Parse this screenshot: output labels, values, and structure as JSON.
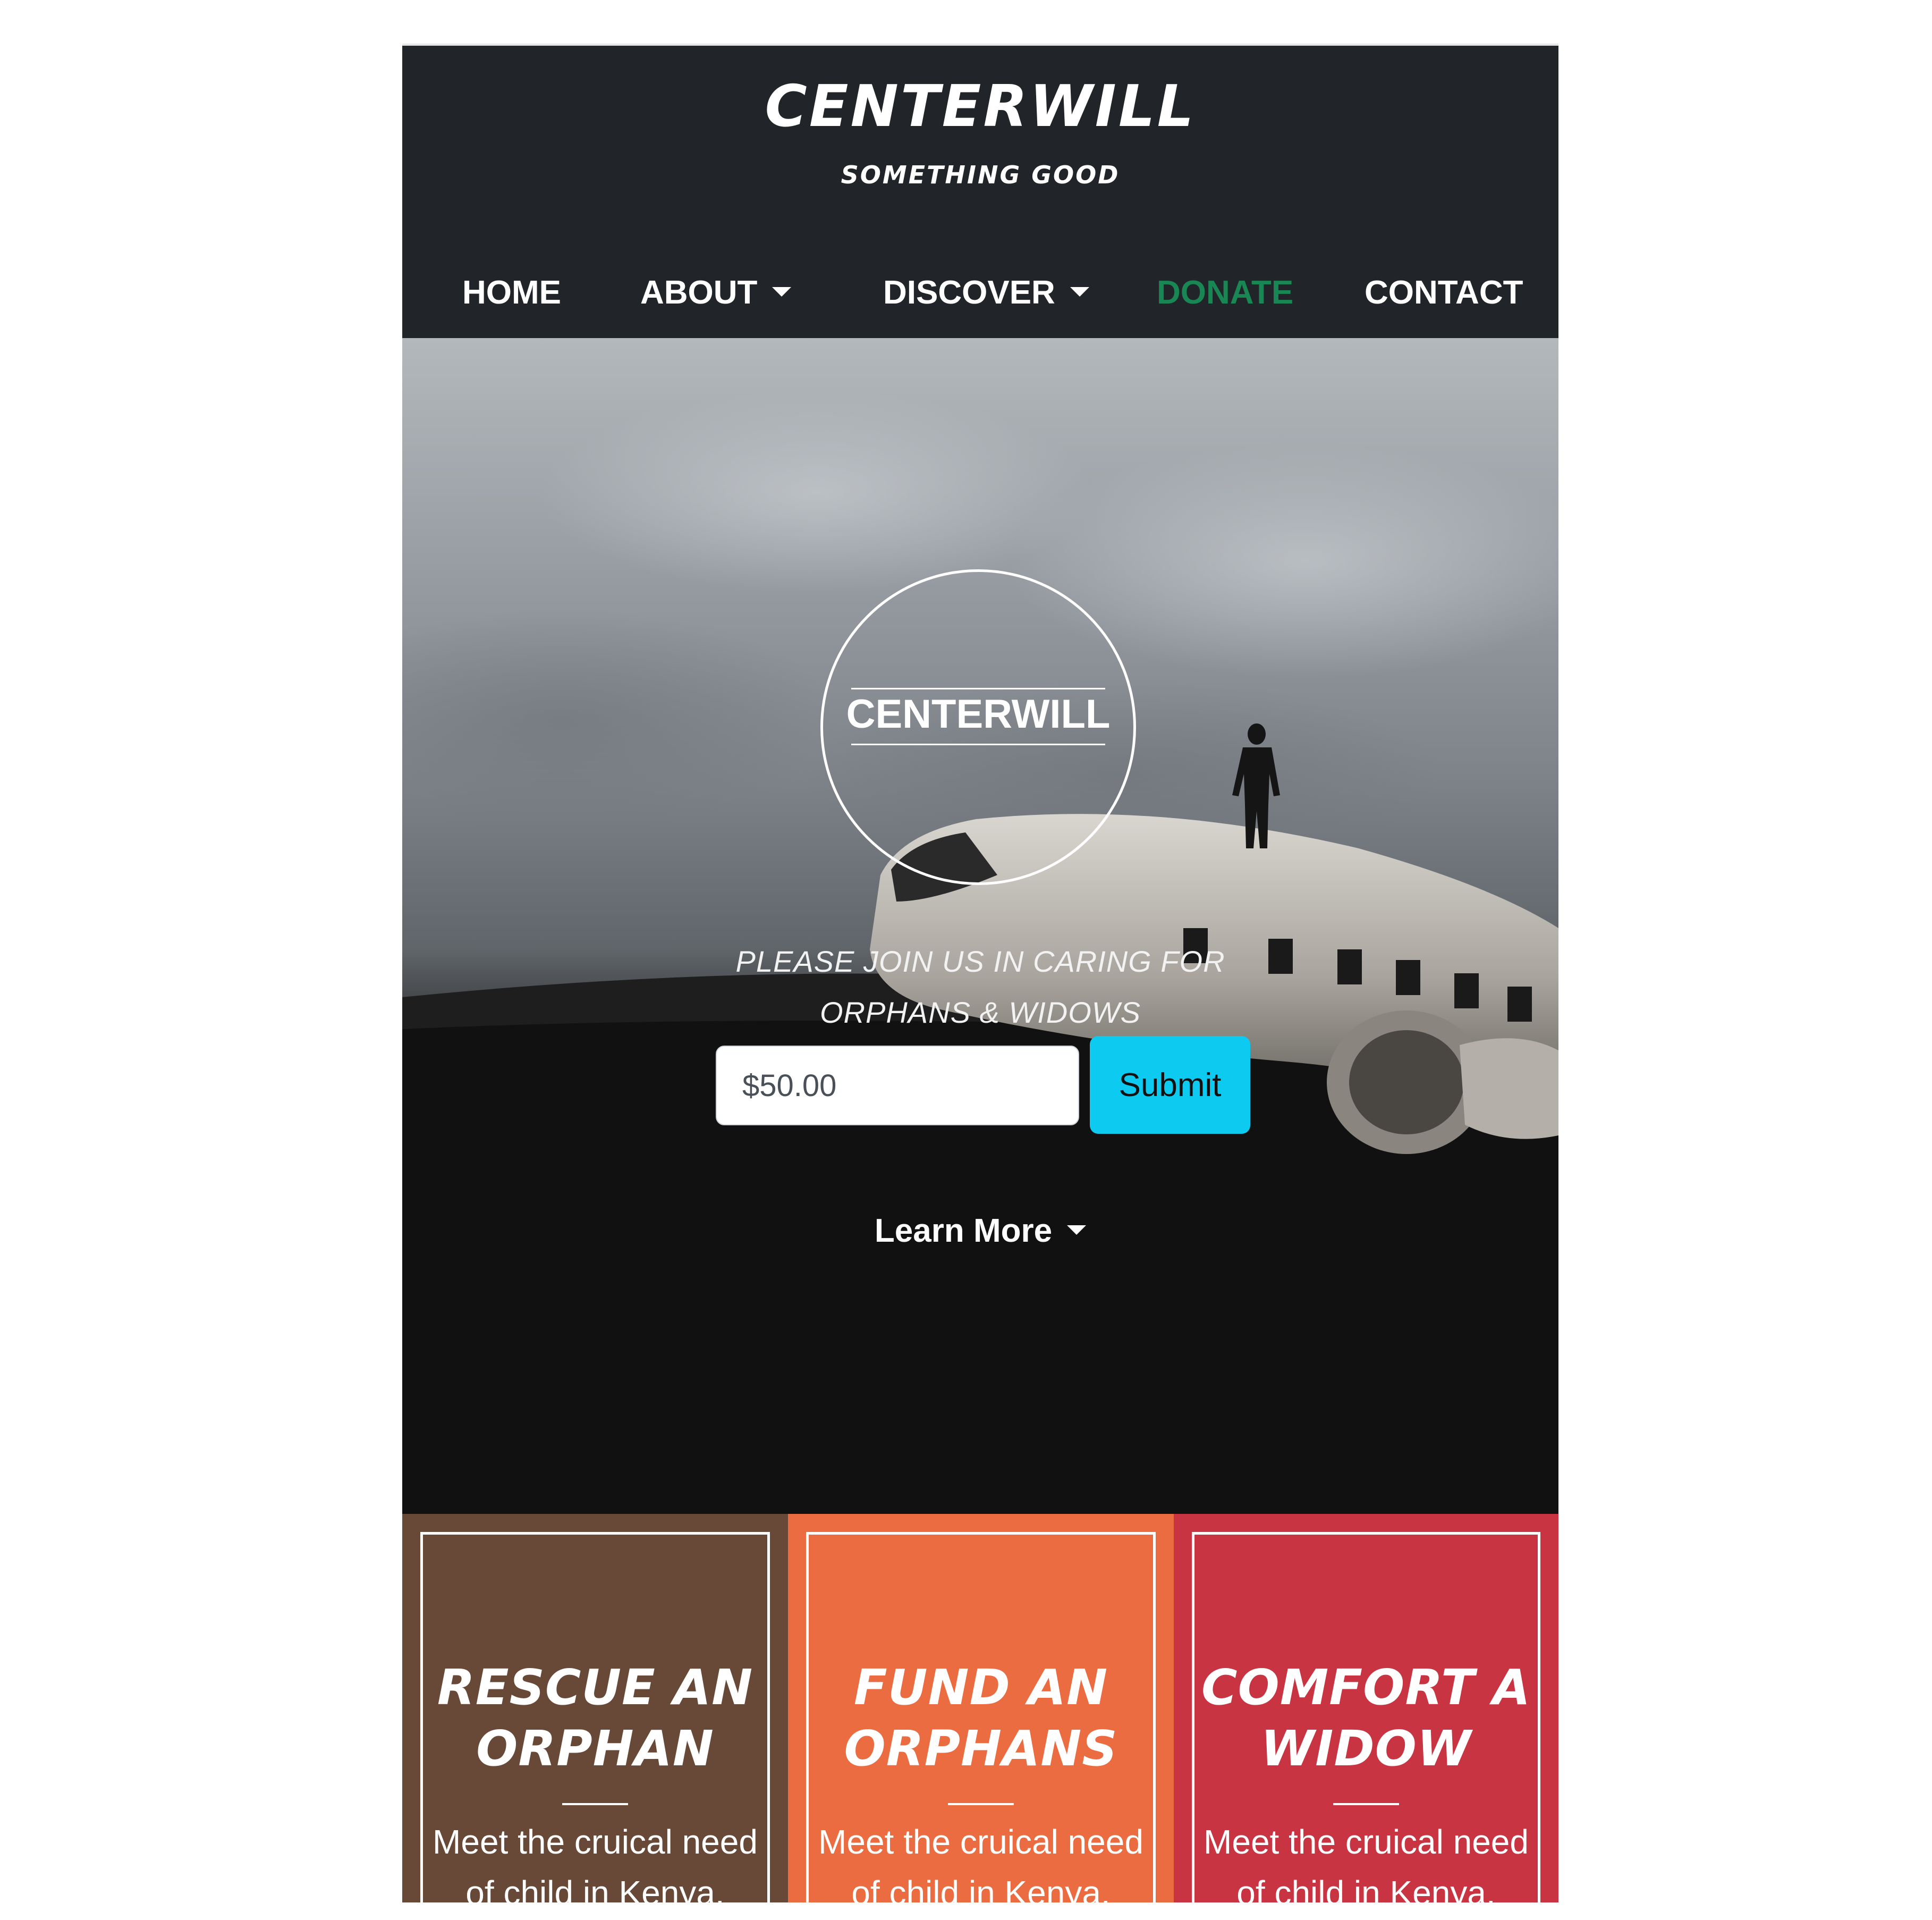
{
  "header": {
    "brand": "CENTERWILL",
    "tagline": "SOMETHING GOOD",
    "nav": [
      {
        "label": "HOME",
        "dropdown": false,
        "active": false
      },
      {
        "label": "ABOUT",
        "dropdown": true,
        "active": false
      },
      {
        "label": "DISCOVER",
        "dropdown": true,
        "active": false
      },
      {
        "label": "DONATE",
        "dropdown": false,
        "active": true
      },
      {
        "label": "CONTACT",
        "dropdown": false,
        "active": false
      }
    ]
  },
  "hero": {
    "emblem_text": "CENTERWILL",
    "subtitle_line1": "PLEASE JOIN US IN CARING FOR",
    "subtitle_line2": "ORPHANS & WIDOWS",
    "amount_value": "$50.00",
    "submit_label": "Submit",
    "learn_more_label": "Learn More"
  },
  "cards": [
    {
      "title_line1": "RESCUE AN",
      "title_line2": "ORPHAN",
      "text_line1": "Meet the cruical need",
      "text_line2": "of child in Kenya.",
      "color": "#684837"
    },
    {
      "title_line1": "FUND AN",
      "title_line2": "ORPHANS",
      "text_line1": "Meet the cruical need",
      "text_line2": "of child in Kenya.",
      "color": "#ea6c40"
    },
    {
      "title_line1": "COMFORT A",
      "title_line2": "WIDOW",
      "text_line1": "Meet the cruical need",
      "text_line2": "of child in Kenya.",
      "color": "#c93442"
    }
  ],
  "colors": {
    "header_bg": "#212529",
    "active_nav": "#198754",
    "submit_bg": "#0dcaf0"
  }
}
